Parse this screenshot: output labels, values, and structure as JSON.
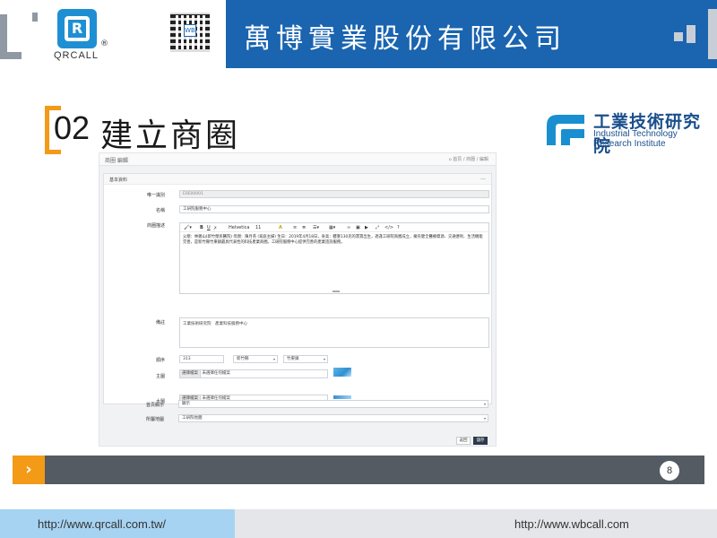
{
  "header": {
    "company": "萬博實業股份有限公司",
    "logo_text": "QRCALL",
    "logo_letter": "R",
    "logo_reg": "®",
    "qr_badge": "WB"
  },
  "slide": {
    "number": "02",
    "title": "建立商圈",
    "page": "8"
  },
  "itri": {
    "zh": "工業技術研究院",
    "en_line1": "Industrial Technology",
    "en_line2": "Research Institute"
  },
  "screenshot": {
    "page_header": "商圈 編輯",
    "breadcrumb": "⌂ 首頁 / 商圈 / 編輯",
    "card_title": "基本資料",
    "collapse": "—",
    "fields": {
      "id_label": "唯一識別",
      "id_value": "E0E00001",
      "name_label": "名稱",
      "name_value": "工研院服務中心",
      "intro_label": "商圈描述",
      "note_label": "備註",
      "note_value": "工業技術研究院　產業科技服務中心",
      "sort_label": "順序",
      "sort_value": "313",
      "city_value": "新竹縣",
      "district_value": "竹東鎮",
      "main_img_label": "主圖",
      "big_img_label": "大圖",
      "file_button": "選擇檔案",
      "file_none": "未選擇任何檔案",
      "show_label": "首頁顯示",
      "show_value": "顯示",
      "map_label": "所屬地圖",
      "map_value": "工研院地圖"
    },
    "toolbar": {
      "font": "Helvetica",
      "size": "11"
    },
    "editor_text": "父親：林錫山(新竹榮民醫院) 母親：陳月英 (家庭主婦) 生日：2019年4月18日，身高：體重130克的寶寶出生，適逢工研院商圈成立，擁有健全醫療資源、交通便利、生活機能完善，是新竹縣竹東鎮最具代表性的科技產業商圈。工研院服務中心提供完善的產業諮詢服務。",
    "buttons": {
      "cancel": "返回",
      "save": "儲存"
    }
  },
  "footer": {
    "url_left": "http://www.qrcall.com.tw/",
    "url_right": "http://www.wbcall.com"
  },
  "colors": {
    "header_blue": "#1a64b0",
    "accent_orange": "#f39a17",
    "footer_left": "#a7d3f2",
    "bottom_bar": "#555b62"
  }
}
